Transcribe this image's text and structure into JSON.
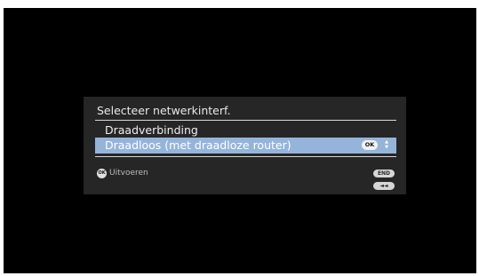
{
  "dialog": {
    "title": "Selecteer netwerkinterf.",
    "options": [
      {
        "label": "Draadverbinding",
        "selected": false
      },
      {
        "label": "Draadloos (met draadloze router)",
        "selected": true
      }
    ],
    "ok_badge": "OK",
    "scroll_arrows": {
      "up": "▲",
      "down": "▼"
    },
    "footer": {
      "ok_icon": "OK",
      "action_label": "Uitvoeren",
      "end_button": "END",
      "back_button": "◄◄"
    }
  },
  "colors": {
    "screen": "#000000",
    "dialog_bg": "#262626",
    "highlight": "#95b4da"
  }
}
